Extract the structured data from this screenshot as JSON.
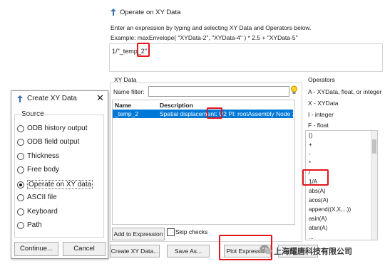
{
  "main": {
    "title": "Operate on XY Data",
    "instruction": "Enter an expression by typing and selecting XY Data and Operators below.",
    "example": "Example: maxEnvelope( \"XYData-2\", \"XYData-4\" ) * 2.5 + \"XYData-5\"",
    "expression": "1/\"_temp_2\"",
    "xy_group_label": "XY Data",
    "name_filter_label": "Name filter:",
    "columns": [
      "Name",
      "Description"
    ],
    "row": {
      "name": "_temp_2",
      "description": "Spatial displacement: U2 PI: rootAssembly Node 1"
    },
    "add_to_expression": "Add to Expression",
    "skip_checks": "Skip checks",
    "operators_label": "Operators",
    "operator_types": [
      "A - XYData, float, or integer",
      "X - XYData",
      "I - integer",
      "F - float"
    ],
    "operators": [
      "()",
      "+",
      "-",
      "*",
      "/",
      "1/A",
      "abs(A)",
      "acos(A)",
      "append((X,X,...))",
      "asin(A)",
      "atan(A)",
      "..."
    ],
    "buttons": {
      "create_xy": "Create XY Data...",
      "save_as": "Save As...",
      "plot": "Plot Expression",
      "cancel": "Cancel"
    }
  },
  "dialog": {
    "title": "Create XY Data",
    "source_label": "Source",
    "options": [
      {
        "label": "ODB history output",
        "selected": false
      },
      {
        "label": "ODB field output",
        "selected": false
      },
      {
        "label": "Thickness",
        "selected": false
      },
      {
        "label": "Free body",
        "selected": false
      },
      {
        "label": "Operate on XY data",
        "selected": true
      },
      {
        "label": "ASCII file",
        "selected": false
      },
      {
        "label": "Keyboard",
        "selected": false
      },
      {
        "label": "Path",
        "selected": false
      }
    ],
    "continue": "Continue...",
    "cancel": "Cancel"
  },
  "watermark": "上海耀唐科技有限公司",
  "colors": {
    "selection": "#0078d7",
    "highlight": "#e2161b",
    "title_icon": "#3a6fb0"
  }
}
